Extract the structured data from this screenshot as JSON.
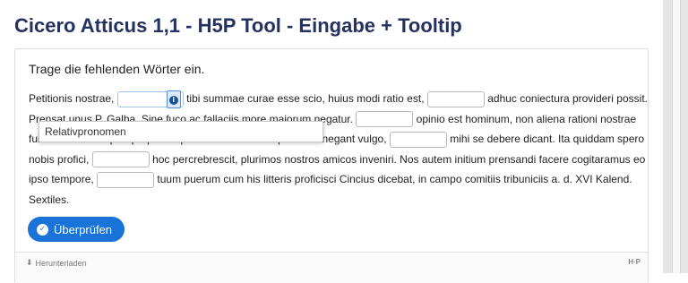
{
  "page": {
    "title": "Cicero Atticus 1,1 - H5P Tool - Eingabe + Tooltip"
  },
  "task": {
    "instruction": "Trage die fehlenden Wörter ein.",
    "segments": [
      "Petitionis nostrae,",
      "tibi summae curae esse scio, huius modi ratio est,",
      "adhuc coniectura provideri possit. Prensat unus P. Galba. Sine fuco ac fallaciis more maiorum negatur.",
      "opinio est hominum, non aliena rationi nostrae fuisse illius hanc praeproperam prensationem. Namque illi ita negant vulgo,",
      "mihi se debere dicant. Ita quiddam spero nobis profici,",
      "hoc percrebrescit, plurimos nostros amicos inveniri. Nos autem initium prensandi facere cogitaramus eo ipso tempore,",
      "tuum puerum cum his litteris proficisci Cincius dicebat, in campo comitiis tribuniciis a. d. XVI Kalend. Sextiles."
    ],
    "tooltip_text": "Relativpronomen",
    "tooltip_icon": "info-icon"
  },
  "actions": {
    "check_label": "Überprüfen",
    "check_icon": "check-circle-icon"
  },
  "footer": {
    "download_label": "Herunterladen",
    "download_icon": "download-icon",
    "logo_text": "H·P"
  },
  "colors": {
    "title": "#25315f",
    "accent": "#1a73d9",
    "tooltip_icon_bg": "#dbe9fb"
  }
}
